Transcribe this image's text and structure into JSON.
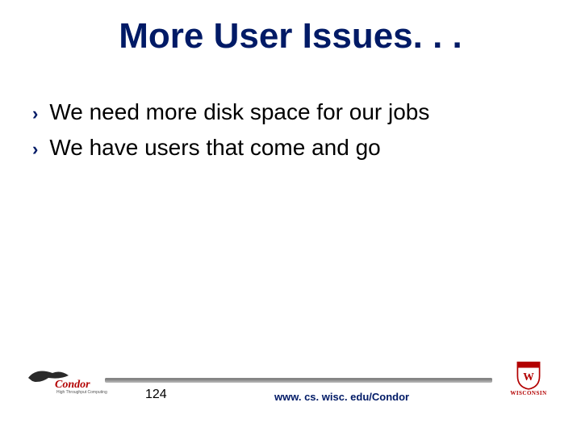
{
  "title": "More User Issues. . .",
  "bullets": [
    "We need more disk space for our jobs",
    "We have users that come and go"
  ],
  "footer": {
    "page_number": "124",
    "url": "www. cs. wisc. edu/Condor",
    "condor_logo_text": "Condor",
    "wisc_logo_text": "WISCONSIN"
  },
  "colors": {
    "accent": "#001a66",
    "wisc_red": "#b30000"
  }
}
